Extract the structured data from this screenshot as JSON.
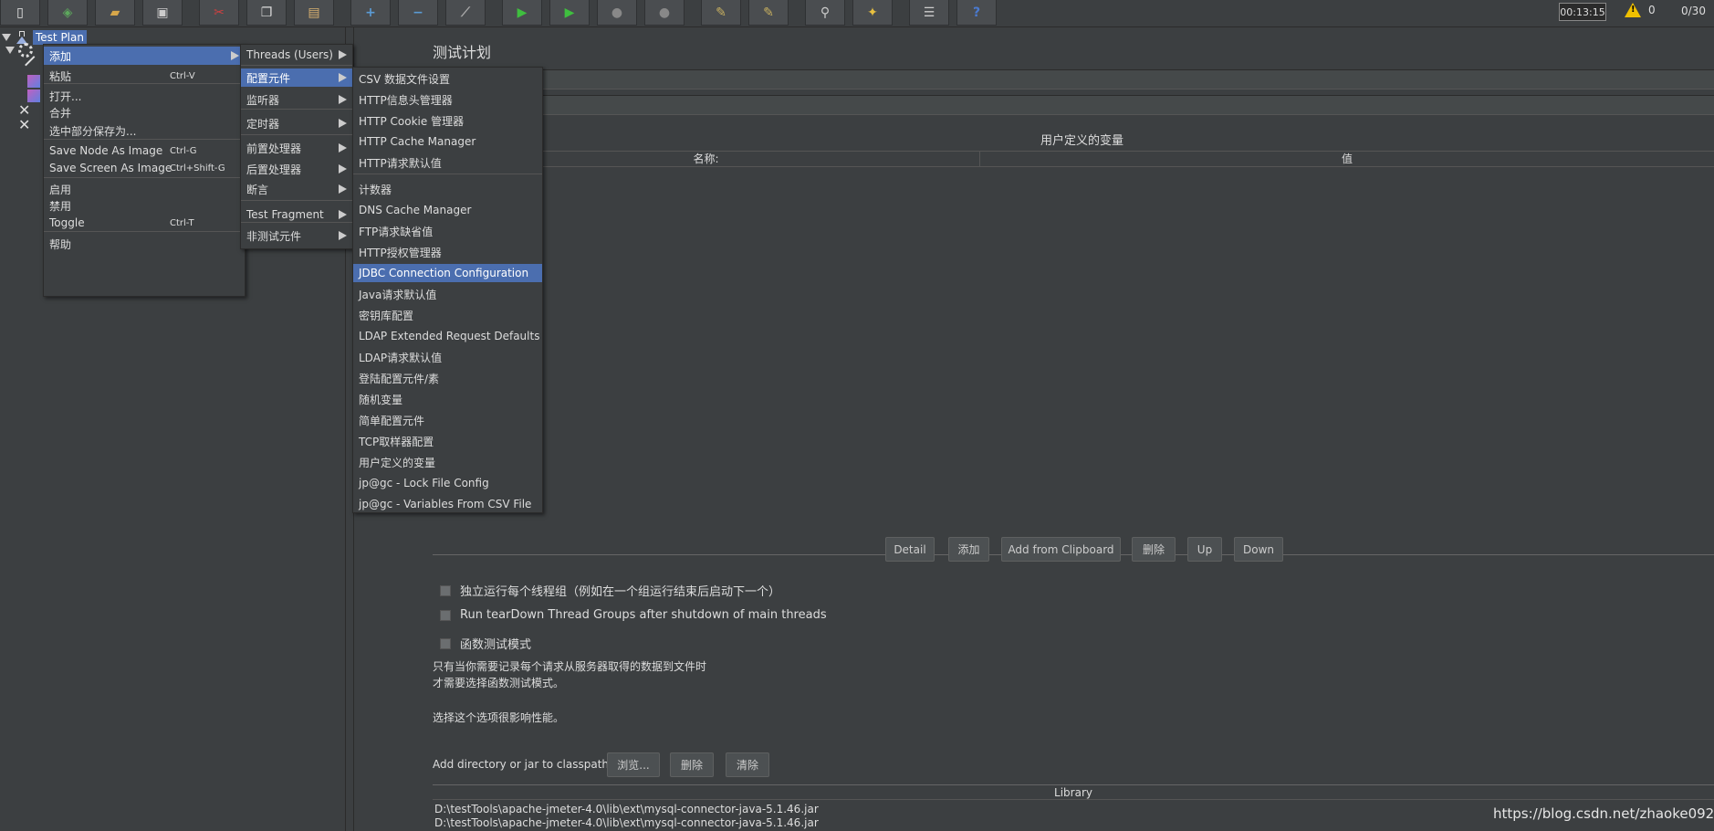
{
  "toolbar": {
    "buttons": [
      {
        "icon": "new-icon",
        "color": "#e8e8e8"
      },
      {
        "icon": "templates-icon",
        "color": "#5da85d"
      },
      {
        "icon": "open-icon",
        "color": "#d7a74a"
      },
      {
        "icon": "save-icon",
        "color": "#cccccc"
      },
      {
        "icon": "cut-icon",
        "color": "#d04040"
      },
      {
        "icon": "copy-icon",
        "color": "#dddddd"
      },
      {
        "icon": "paste-icon",
        "color": "#d7b070"
      },
      {
        "icon": "expand-icon",
        "color": "#5b9bd5"
      },
      {
        "icon": "collapse-icon",
        "color": "#5b9bd5"
      },
      {
        "icon": "toggle-icon",
        "color": "#aaaaaa"
      },
      {
        "icon": "start-icon",
        "color": "#3fbf3f"
      },
      {
        "icon": "start-no-pause-icon",
        "color": "#3fbf3f"
      },
      {
        "icon": "stop-icon",
        "color": "#888888"
      },
      {
        "icon": "shutdown-icon",
        "color": "#888888"
      },
      {
        "icon": "clear-icon",
        "color": "#c8b060"
      },
      {
        "icon": "clear-all-icon",
        "color": "#c8b060"
      },
      {
        "icon": "search-icon",
        "color": "#cccccc"
      },
      {
        "icon": "reset-search-icon",
        "color": "#e8c040"
      },
      {
        "icon": "function-helper-icon",
        "color": "#cccccc"
      },
      {
        "icon": "help-icon",
        "color": "#4a7ad0"
      }
    ],
    "timer": "00:13:15",
    "warning_count": "0",
    "threads": "0/30"
  },
  "tree": {
    "root_label": "Test Plan"
  },
  "context_menu": {
    "items": [
      {
        "label": "添加",
        "shortcut": "",
        "has_submenu": true,
        "selected": true
      },
      {
        "label": "粘贴",
        "shortcut": "Ctrl-V",
        "has_submenu": false,
        "selected": false
      },
      {
        "label": "打开...",
        "shortcut": "",
        "has_submenu": false,
        "selected": false
      },
      {
        "label": "合并",
        "shortcut": "",
        "has_submenu": false,
        "selected": false
      },
      {
        "label": "选中部分保存为...",
        "shortcut": "",
        "has_submenu": false,
        "selected": false
      },
      {
        "label": "Save Node As Image",
        "shortcut": "Ctrl-G",
        "has_submenu": false,
        "selected": false
      },
      {
        "label": "Save Screen As Image",
        "shortcut": "Ctrl+Shift-G",
        "has_submenu": false,
        "selected": false
      },
      {
        "label": "启用",
        "shortcut": "",
        "has_submenu": false,
        "selected": false
      },
      {
        "label": "禁用",
        "shortcut": "",
        "has_submenu": false,
        "selected": false
      },
      {
        "label": "Toggle",
        "shortcut": "Ctrl-T",
        "has_submenu": false,
        "selected": false
      },
      {
        "label": "帮助",
        "shortcut": "",
        "has_submenu": false,
        "selected": false
      }
    ]
  },
  "add_submenu": {
    "items": [
      {
        "label": "Threads (Users)",
        "selected": false
      },
      {
        "label": "配置元件",
        "selected": true
      },
      {
        "label": "监听器",
        "selected": false
      },
      {
        "label": "定时器",
        "selected": false
      },
      {
        "label": "前置处理器",
        "selected": false
      },
      {
        "label": "后置处理器",
        "selected": false
      },
      {
        "label": "断言",
        "selected": false
      },
      {
        "label": "Test Fragment",
        "selected": false
      },
      {
        "label": "非测试元件",
        "selected": false
      }
    ]
  },
  "config_submenu": {
    "items": [
      {
        "label": "CSV 数据文件设置",
        "selected": false
      },
      {
        "label": "HTTP信息头管理器",
        "selected": false
      },
      {
        "label": "HTTP Cookie 管理器",
        "selected": false
      },
      {
        "label": "HTTP Cache Manager",
        "selected": false
      },
      {
        "label": "HTTP请求默认值",
        "selected": false
      },
      {
        "label": "计数器",
        "selected": false
      },
      {
        "label": "DNS Cache Manager",
        "selected": false
      },
      {
        "label": "FTP请求缺省值",
        "selected": false
      },
      {
        "label": "HTTP授权管理器",
        "selected": false
      },
      {
        "label": "JDBC Connection Configuration",
        "selected": true
      },
      {
        "label": "Java请求默认值",
        "selected": false
      },
      {
        "label": "密钥库配置",
        "selected": false
      },
      {
        "label": "LDAP Extended Request Defaults",
        "selected": false
      },
      {
        "label": "LDAP请求默认值",
        "selected": false
      },
      {
        "label": "登陆配置元件/素",
        "selected": false
      },
      {
        "label": "随机变量",
        "selected": false
      },
      {
        "label": "简单配置元件",
        "selected": false
      },
      {
        "label": "TCP取样器配置",
        "selected": false
      },
      {
        "label": "用户定义的变量",
        "selected": false
      },
      {
        "label": "jp@gc - Lock File Config",
        "selected": false
      },
      {
        "label": "jp@gc - Variables From CSV File",
        "selected": false
      }
    ]
  },
  "main": {
    "title": "测试计划",
    "variables_label": "用户定义的变量",
    "columns": [
      "名称:",
      "值"
    ],
    "buttons": [
      "Detail",
      "添加",
      "Add from Clipboard",
      "删除",
      "Up",
      "Down"
    ],
    "checkboxes": [
      "独立运行每个线程组（例如在一个组运行结束后启动下一个）",
      "Run tearDown Thread Groups after shutdown of main threads",
      "函数测试模式"
    ],
    "note_line1": "只有当你需要记录每个请求从服务器取得的数据到文件时",
    "note_line2": "才需要选择函数测试模式。",
    "note_line3": "选择这个选项很影响性能。",
    "classpath_label": "Add directory or jar to classpath",
    "classpath_buttons": [
      "浏览...",
      "删除",
      "清除"
    ],
    "library_header": "Library",
    "library_rows": [
      "D:\\testTools\\apache-jmeter-4.0\\lib\\ext\\mysql-connector-java-5.1.46.jar",
      "D:\\testTools\\apache-jmeter-4.0\\lib\\ext\\mysql-connector-java-5.1.46.jar"
    ]
  },
  "watermark": "https://blog.csdn.net/zhaoke0926"
}
